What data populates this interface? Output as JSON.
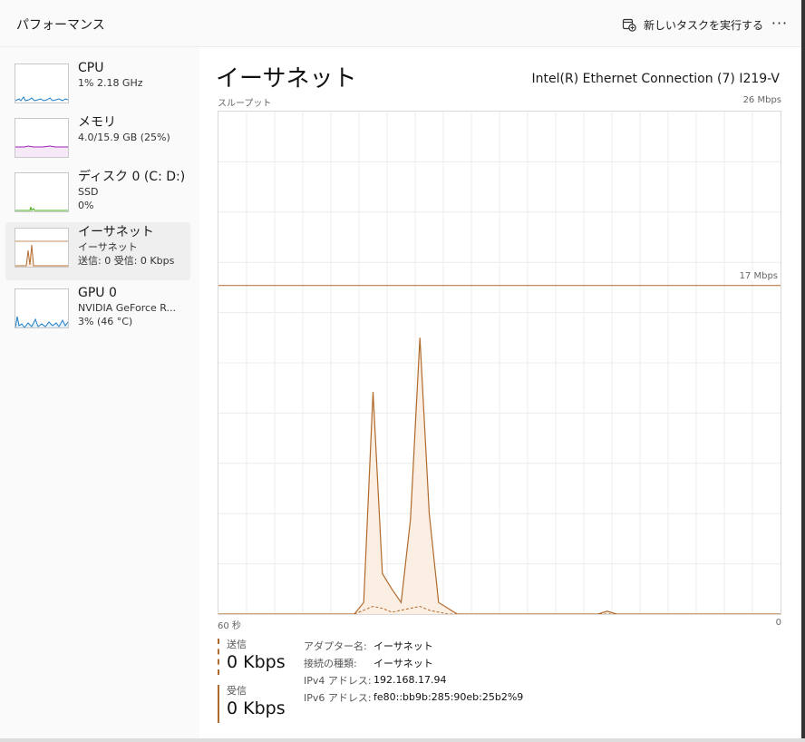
{
  "header": {
    "title": "パフォーマンス",
    "run_task_label": "新しいタスクを実行する",
    "more_label": "···"
  },
  "sidebar": {
    "items": [
      {
        "title": "CPU",
        "line1": "1%  2.18 GHz",
        "line2": "",
        "color": "#1f7fc4"
      },
      {
        "title": "メモリ",
        "line1": "4.0/15.9 GB (25%)",
        "line2": "",
        "color": "#9b1fb5"
      },
      {
        "title": "ディスク 0 (C: D:)",
        "line1": "SSD",
        "line2": "0%",
        "color": "#4caf1f"
      },
      {
        "title": "イーサネット",
        "line1": "イーサネット",
        "line2": "送信: 0  受信: 0 Kbps",
        "color": "#b06a2c"
      },
      {
        "title": "GPU 0",
        "line1": "NVIDIA GeForce R...",
        "line2": "3%  (46 °C)",
        "color": "#1f7fc4"
      }
    ]
  },
  "main": {
    "heading": "イーサネット",
    "adapter_model": "Intel(R) Ethernet Connection (7) I219-V",
    "throughput_label": "スループット",
    "max_label": "26 Mbps",
    "ref_label": "17 Mbps",
    "x_left_label": "60 秒",
    "x_right_label": "0"
  },
  "legend": {
    "send_title": "送信",
    "send_value": "0 Kbps",
    "recv_title": "受信",
    "recv_value": "0 Kbps"
  },
  "info": [
    {
      "key": "アダプター名:",
      "value": "イーサネット"
    },
    {
      "key": "接続の種類:",
      "value": "イーサネット"
    },
    {
      "key": "IPv4 アドレス:",
      "value": "192.168.17.94"
    },
    {
      "key": "IPv6 アドレス:",
      "value": "fe80::bb9b:285:90eb:25b2%9"
    }
  ],
  "chart_data": {
    "type": "area",
    "y_unit": "Mbps",
    "ylim": [
      0,
      26
    ],
    "x_range_seconds": [
      60,
      0
    ],
    "reference_line": 17,
    "grid": true,
    "color": "#b06a2c",
    "fill": "#fbeee3",
    "series": [
      {
        "style": "solid",
        "x": [
          60,
          45.5,
          44.5,
          43.5,
          42.5,
          41.5,
          40.5,
          39.5,
          38.5,
          37.5,
          36.5,
          35.5,
          34.5,
          33.5,
          32.5,
          31.5,
          30.5,
          29.5,
          28.5,
          19.5,
          18.5,
          17.5,
          0
        ],
        "values": [
          0,
          0,
          0.6,
          11.5,
          2.1,
          1.3,
          0.6,
          4.9,
          14.3,
          5.2,
          0.6,
          0.3,
          0,
          0,
          0,
          0,
          0,
          0,
          0,
          0,
          0.15,
          0,
          0
        ]
      },
      {
        "style": "dashed",
        "x": [
          60,
          45.5,
          44.5,
          43.5,
          42.5,
          41.5,
          40.5,
          39.5,
          38.5,
          37.5,
          36.5,
          35.5,
          0
        ],
        "values": [
          0,
          0,
          0.2,
          0.4,
          0.3,
          0.1,
          0.2,
          0.3,
          0.4,
          0.2,
          0.1,
          0,
          0
        ]
      }
    ]
  }
}
